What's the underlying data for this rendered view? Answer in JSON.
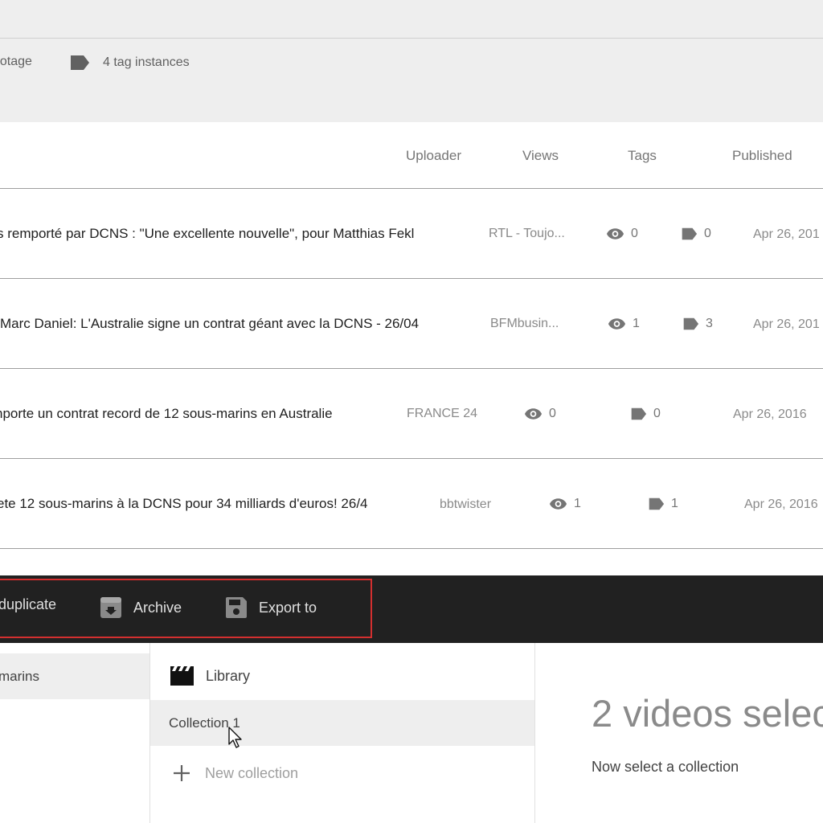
{
  "stats": {
    "footage_label": "ootage",
    "tag_instances_label": "4 tag instances"
  },
  "table": {
    "columns": {
      "uploader": "Uploader",
      "views": "Views",
      "tags": "Tags",
      "published": "Published"
    },
    "rows": [
      {
        "title": "s remporté par DCNS : \"Une excellente nouvelle\", pour Matthias Fekl",
        "uploader": "RTL - Toujo...",
        "views": "0",
        "tags": "0",
        "published": "Apr 26, 201"
      },
      {
        "title": "Marc Daniel: L'Australie signe un contrat géant avec la DCNS - 26/04",
        "uploader": "BFMbusin...",
        "views": "1",
        "tags": "3",
        "published": "Apr 26, 201"
      },
      {
        "title": "nporte un contrat record de 12 sous-marins en Australie",
        "uploader": "FRANCE 24",
        "views": "0",
        "tags": "0",
        "published": "Apr 26, 2016"
      },
      {
        "title": "ete 12 sous-marins à la DCNS pour 34 milliards d'euros! 26/4",
        "uploader": "bbtwister",
        "views": "1",
        "tags": "1",
        "published": "Apr 26, 2016"
      }
    ]
  },
  "actions": {
    "duplicate": "duplicate",
    "archive": "Archive",
    "export": "Export to"
  },
  "left_panel": {
    "selected_item": "marins"
  },
  "collections": {
    "library": "Library",
    "items": [
      "Collection 1"
    ],
    "new_collection": "New collection"
  },
  "selection": {
    "count_text": "2 videos selec",
    "hint": "Now select a collection"
  },
  "icons": {
    "tag": "tag-icon",
    "views": "eye-icon",
    "archive": "archive-icon",
    "export": "save-icon",
    "library": "clapperboard-icon",
    "add": "plus-icon",
    "cursor": "mouse-pointer-icon"
  },
  "colors": {
    "action_bar": "#212121",
    "highlight_border": "#d32f2f",
    "selected_bg": "#eeeeee"
  }
}
